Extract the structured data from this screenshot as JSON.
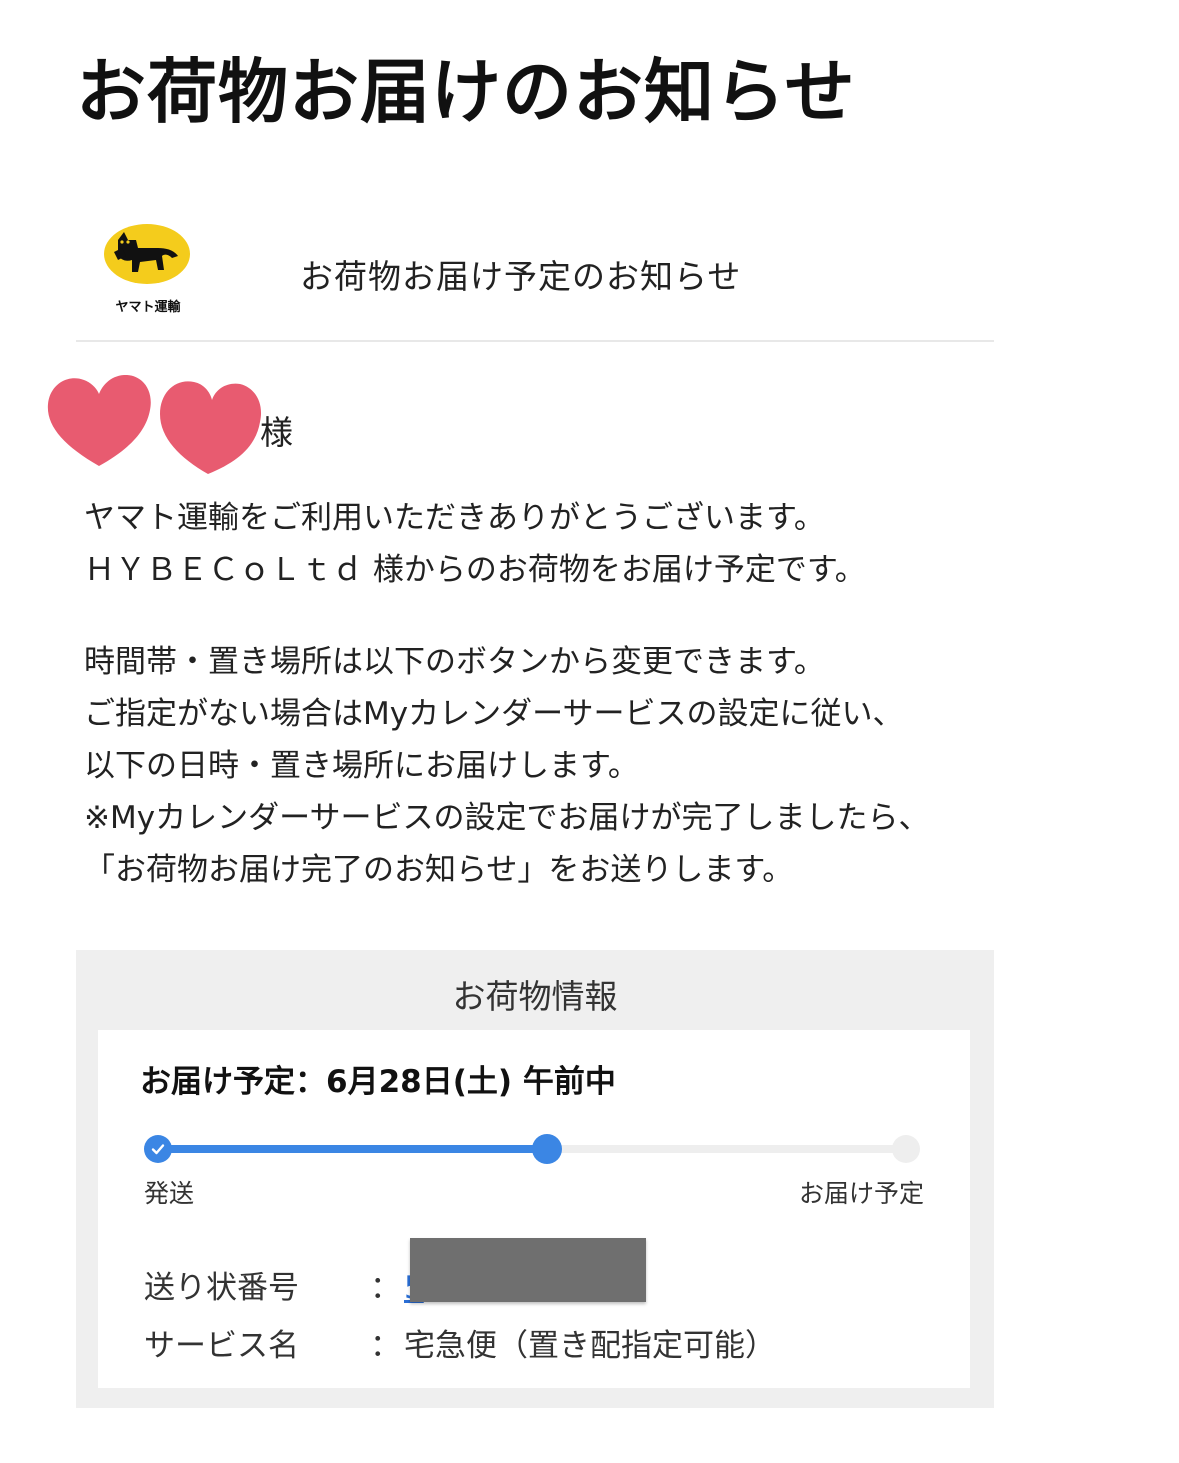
{
  "page_title": "お荷物お届けのお知らせ",
  "header": {
    "logo_text": "ヤマト運輸",
    "title": "お荷物お届け予定のお知らせ"
  },
  "recipient": {
    "suffix": "様"
  },
  "intro_paragraph": [
    "ヤマト運輸をご利用いただきありがとうございます。",
    "ＨＹＢＥＣｏＬｔｄ 様からのお荷物をお届け予定です。"
  ],
  "notice_paragraph": [
    "時間帯・置き場所は以下のボタンから変更できます。",
    "ご指定がない場合はMyカレンダーサービスの設定に従い、",
    "以下の日時・置き場所にお届けします。",
    "※Myカレンダーサービスの設定でお届けが完了しましたら、",
    "「お荷物お届け完了のお知らせ」をお送りします。"
  ],
  "package_info": {
    "heading": "お荷物情報",
    "delivery_schedule": "お届け予定：6月28日(土) 午前中",
    "progress": {
      "value": 0.52,
      "start_label": "発送",
      "end_label": "お届け予定",
      "accent_color": "#3b86e4"
    },
    "tracking_label": "送り状番号",
    "tracking_value": "5",
    "service_label": "サービス名",
    "service_value": "宅急便（置き配指定可能）",
    "colon": "："
  }
}
